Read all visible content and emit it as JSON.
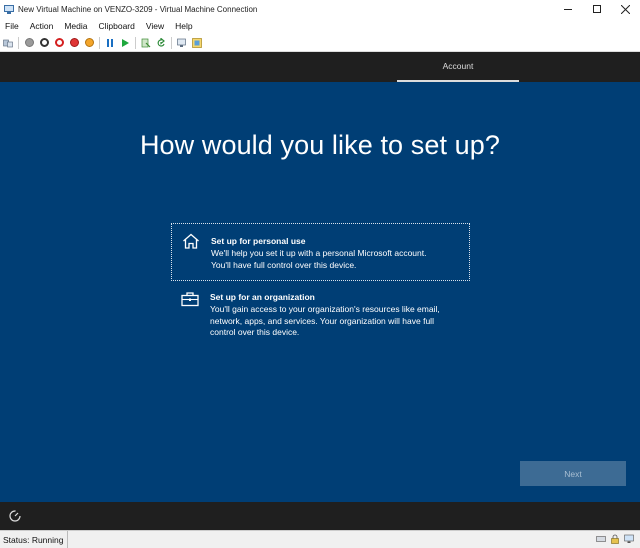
{
  "window": {
    "title": "New Virtual Machine on VENZO-3209 - Virtual Machine Connection",
    "minimize": "–",
    "maximize": "□",
    "close": "✕"
  },
  "menu": {
    "items": [
      "File",
      "Action",
      "Media",
      "Clipboard",
      "View",
      "Help"
    ]
  },
  "oobe": {
    "tab": "Account",
    "heading": "How would you like to set up?",
    "options": [
      {
        "title": "Set up for personal use",
        "line1": "We'll help you set it up with a personal Microsoft account.",
        "line2": "You'll have full control over this device.",
        "line3": "",
        "icon": "home-icon"
      },
      {
        "title": "Set up for an organization",
        "line1": "You'll gain access to your organization's resources like email,",
        "line2": "network, apps, and services. Your organization will have full",
        "line3": "control over this device.",
        "icon": "briefcase-icon"
      }
    ],
    "next_label": "Next"
  },
  "status": {
    "text": "Status: Running"
  },
  "colors": {
    "oobe_blue": "#003e75",
    "dark_bar": "#1f1f1f",
    "next_disabled_bg": "#3d6b94",
    "next_disabled_text": "#a9bfd3"
  }
}
